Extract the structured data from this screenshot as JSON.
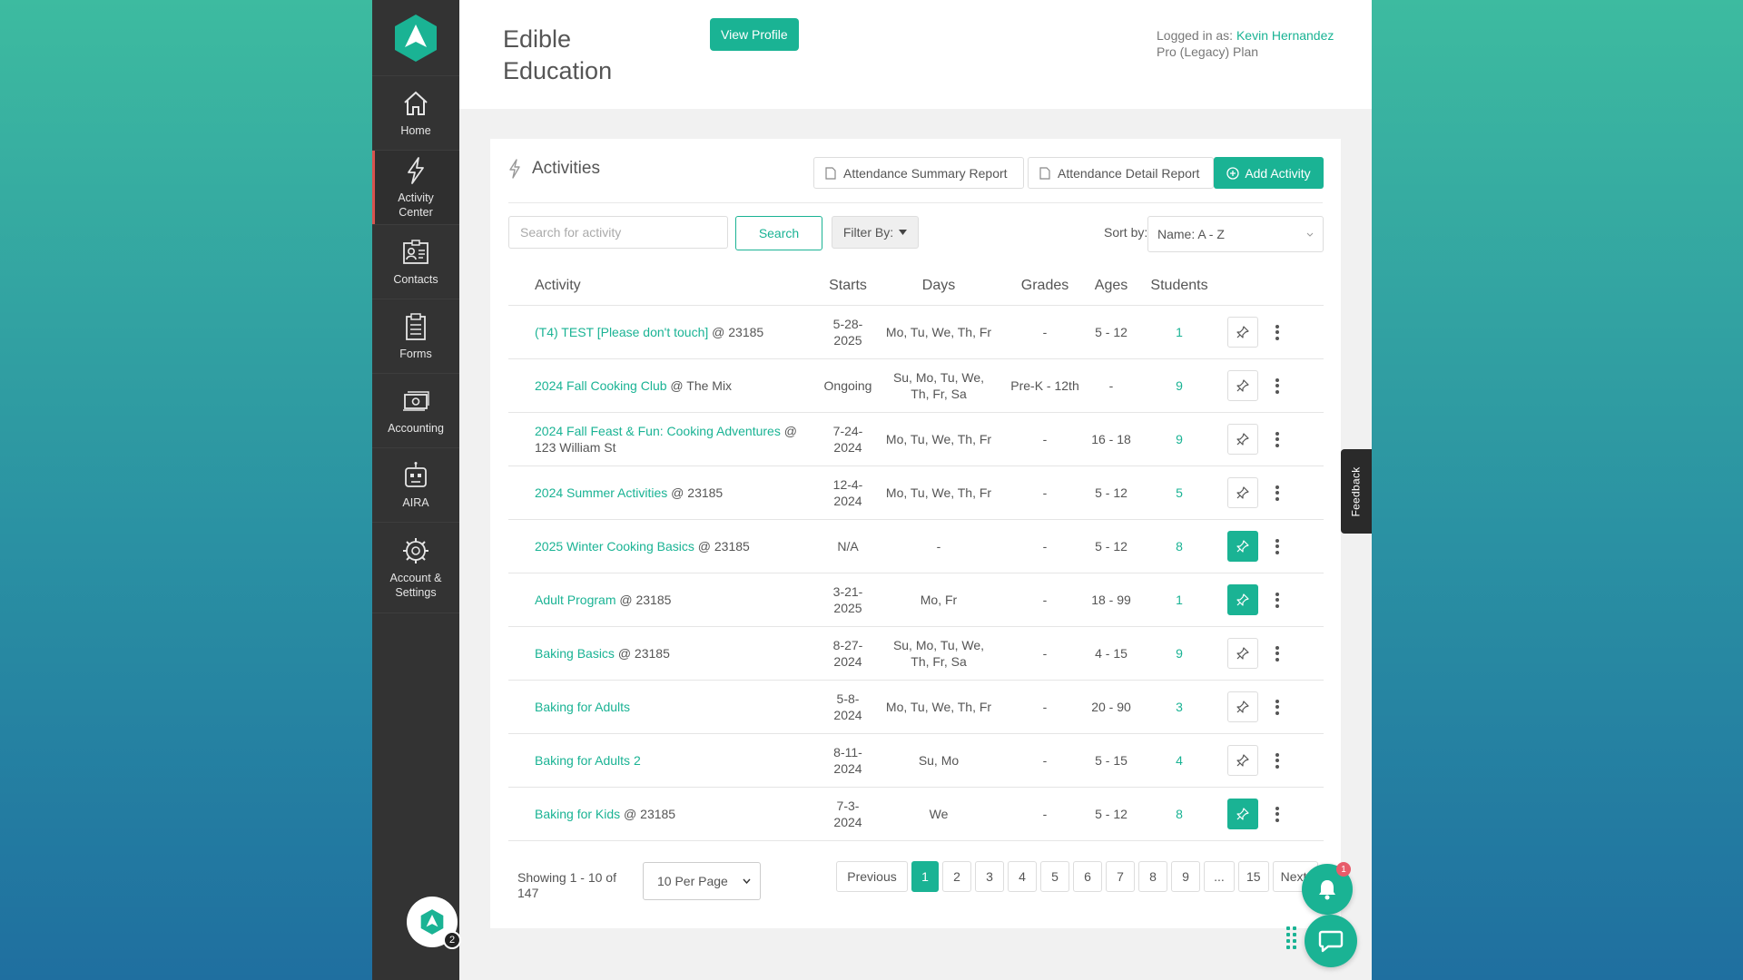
{
  "sidebar": {
    "items": [
      {
        "label": "Home",
        "icon": "home-icon"
      },
      {
        "label": "Activity Center",
        "icon": "lightning-icon"
      },
      {
        "label": "Contacts",
        "icon": "contacts-icon"
      },
      {
        "label": "Forms",
        "icon": "clipboard-icon"
      },
      {
        "label": "Accounting",
        "icon": "money-icon"
      },
      {
        "label": "AIRA",
        "icon": "robot-icon"
      },
      {
        "label": "Account & Settings",
        "icon": "gear-icon"
      }
    ],
    "avatar_badge": "2"
  },
  "header": {
    "org_name": "Edible Education",
    "view_profile_label": "View Profile",
    "logged_in_prefix": "Logged in as:",
    "user_name": "Kevin Hernandez",
    "plan": "Pro (Legacy) Plan"
  },
  "card": {
    "title": "Activities",
    "attendance_summary_label": "Attendance Summary Report",
    "attendance_detail_label": "Attendance Detail Report",
    "add_activity_label": "Add Activity",
    "search_placeholder": "Search for activity",
    "search_label": "Search",
    "filter_label": "Filter By:",
    "sort_label": "Sort by:",
    "sort_value": "Name: A - Z"
  },
  "table": {
    "headers": {
      "activity": "Activity",
      "starts": "Starts",
      "days": "Days",
      "grades": "Grades",
      "ages": "Ages",
      "students": "Students"
    },
    "rows": [
      {
        "name": "(T4) TEST [Please don't touch]",
        "location": " @ 23185",
        "starts": "5-28-2025",
        "days": "Mo, Tu, We, Th, Fr",
        "grades": "-",
        "ages": "5 - 12",
        "students": "1",
        "pinned": false
      },
      {
        "name": "2024 Fall Cooking Club",
        "location": " @ The Mix",
        "starts": "Ongoing",
        "days": "Su, Mo, Tu, We, Th, Fr, Sa",
        "grades": "Pre-K - 12th",
        "ages": "-",
        "students": "9",
        "pinned": false
      },
      {
        "name": "2024 Fall Feast & Fun: Cooking Adventures",
        "location": " @ 123 William St",
        "starts": "7-24-2024",
        "days": "Mo, Tu, We, Th, Fr",
        "grades": "-",
        "ages": "16 - 18",
        "students": "9",
        "pinned": false
      },
      {
        "name": "2024 Summer Activities",
        "location": " @ 23185",
        "starts": "12-4-2024",
        "days": "Mo, Tu, We, Th, Fr",
        "grades": "-",
        "ages": "5 - 12",
        "students": "5",
        "pinned": false
      },
      {
        "name": "2025 Winter Cooking Basics",
        "location": " @ 23185",
        "starts": "N/A",
        "days": "-",
        "grades": "-",
        "ages": "5 - 12",
        "students": "8",
        "pinned": true
      },
      {
        "name": "Adult Program",
        "location": " @ 23185",
        "starts": "3-21-2025",
        "days": "Mo, Fr",
        "grades": "-",
        "ages": "18 - 99",
        "students": "1",
        "pinned": true
      },
      {
        "name": "Baking Basics",
        "location": " @ 23185",
        "starts": "8-27-2024",
        "days": "Su, Mo, Tu, We, Th, Fr, Sa",
        "grades": "-",
        "ages": "4 - 15",
        "students": "9",
        "pinned": false
      },
      {
        "name": "Baking for Adults",
        "location": "",
        "starts": "5-8-2024",
        "days": "Mo, Tu, We, Th, Fr",
        "grades": "-",
        "ages": "20 - 90",
        "students": "3",
        "pinned": false
      },
      {
        "name": "Baking for Adults 2",
        "location": "",
        "starts": "8-11-2024",
        "days": "Su, Mo",
        "grades": "-",
        "ages": "5 - 15",
        "students": "4",
        "pinned": false
      },
      {
        "name": "Baking for Kids",
        "location": " @ 23185",
        "starts": "7-3-2024",
        "days": "We",
        "grades": "-",
        "ages": "5 - 12",
        "students": "8",
        "pinned": true
      }
    ]
  },
  "footer": {
    "showing": "Showing 1 - 10 of 147",
    "per_page": "10 Per Page",
    "previous": "Previous",
    "pages": [
      "1",
      "2",
      "3",
      "4",
      "5",
      "6",
      "7",
      "8",
      "9",
      "...",
      "15"
    ],
    "current_page": "1",
    "next": "Next"
  },
  "feedback_label": "Feedback",
  "notification_count": "1",
  "colors": {
    "accent": "#1ab394",
    "sidebar": "#333333",
    "badge": "#e85b6a"
  }
}
